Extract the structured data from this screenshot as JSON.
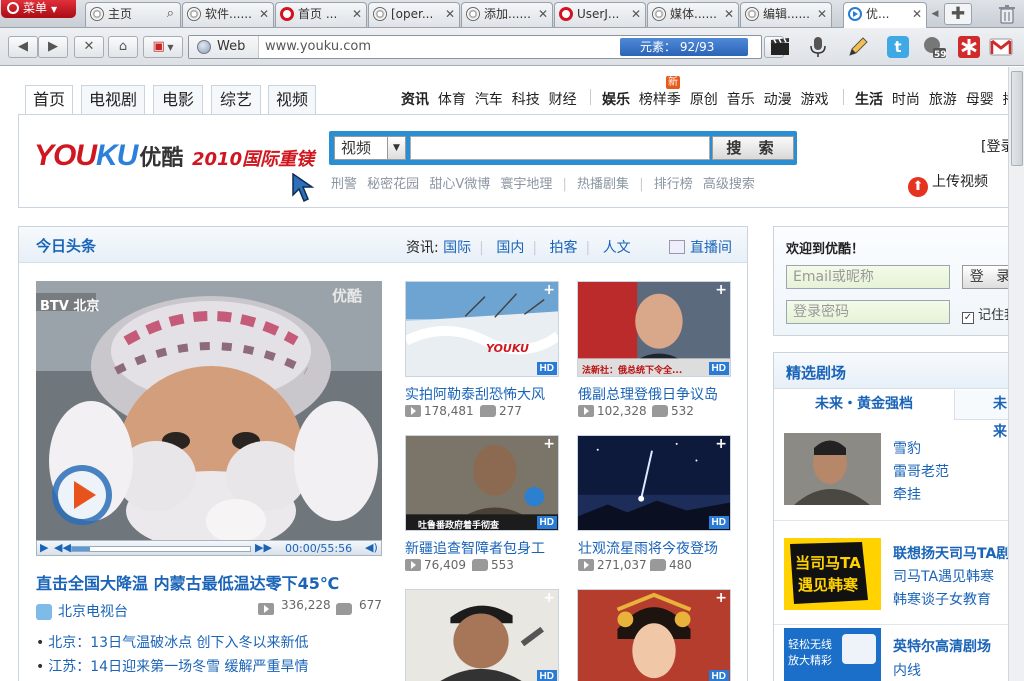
{
  "browser": {
    "menu_label": "菜单",
    "tabs": [
      {
        "label": "主页",
        "icon": "swirl-icon"
      },
      {
        "label": "软件......",
        "icon": "swirl-icon"
      },
      {
        "label": "首页 ...",
        "icon": "opera-icon"
      },
      {
        "label": "[oper...",
        "icon": "dog-icon"
      },
      {
        "label": "添加......",
        "icon": "dog-icon"
      },
      {
        "label": "UserJ...",
        "icon": "opera-icon"
      },
      {
        "label": "媒体......",
        "icon": "dog-icon"
      },
      {
        "label": "编辑......",
        "icon": "dog-icon"
      },
      {
        "label": "优...",
        "icon": "youku-icon"
      }
    ],
    "address": {
      "web_label": "Web",
      "url": "www.youku.com",
      "element_badge": "元素：    92/93"
    },
    "badge_count": "59"
  },
  "site": {
    "channel_tabs": [
      "首页",
      "电视剧",
      "电影",
      "综艺",
      "视频"
    ],
    "subnav_groups": [
      {
        "lead": "资讯",
        "items": [
          "体育",
          "汽车",
          "科技",
          "财经"
        ]
      },
      {
        "lead": "娱乐",
        "items": [
          "榜样季",
          "原创",
          "音乐",
          "动漫",
          "游戏"
        ]
      },
      {
        "lead": "生活",
        "items": [
          "时尚",
          "旅游",
          "母婴",
          "播"
        ]
      }
    ],
    "new_badge": "新",
    "logo": {
      "you": "YOU",
      "ku": "KU",
      "cn": "优酷",
      "slogan": "2010国际重镁"
    },
    "search": {
      "category": "视频",
      "button": "搜 索",
      "hotwords": [
        "刑警",
        "秘密花园",
        "甜心V微博",
        "寰宇地理"
      ],
      "hotlinks": [
        "热播剧集",
        "排行榜",
        "高级搜索"
      ]
    },
    "login_link": "[登录",
    "upload_label": "上传视频"
  },
  "news": {
    "title": "今日头条",
    "links_lead": "资讯:",
    "links": [
      "国际",
      "国内",
      "拍客",
      "人文"
    ],
    "live": "直播间",
    "main_video": {
      "watermark_left": "BTV 北京",
      "watermark_right": "优酷",
      "time": "00:00/55:56",
      "headline": "直击全国大降温 内蒙古最低温达零下45℃",
      "source": "北京电视台",
      "plays": "336,228",
      "comments": "677"
    },
    "bullets": [
      "北京：13日气温破冰点 创下入冬以来新低",
      "江苏：14日迎来第一场冬雪 缓解严重旱情"
    ],
    "thumbs": [
      {
        "title": "实拍阿勒泰刮恐怖大风",
        "plays": "178,481",
        "comments": "277",
        "hd": "HD",
        "logo": "YOUKU"
      },
      {
        "title": "俄副总理登俄日争议岛",
        "plays": "102,328",
        "comments": "532",
        "hd": "HD",
        "caption": "法新社：俄总统下令全..."
      },
      {
        "title": "新疆追查智障者包身工",
        "plays": "76,409",
        "comments": "553",
        "hd": "HD",
        "caption": "吐鲁番政府着手彻查"
      },
      {
        "title": "壮观流星雨将今夜登场",
        "plays": "271,037",
        "comments": "480",
        "hd": "HD"
      },
      {
        "title": "",
        "hd": "HD"
      },
      {
        "title": "",
        "hd": "HD"
      }
    ]
  },
  "login": {
    "welcome": "欢迎到优酷！",
    "user_placeholder": "Email或昵称",
    "pass_placeholder": "登录密码",
    "button": "登 录",
    "remember": "记住我"
  },
  "theater": {
    "title": "精选剧场",
    "tabs": [
      "未来・黄金强档",
      "未来"
    ],
    "rows": [
      {
        "links": [
          "雪豹",
          "雷哥老范",
          "牵挂"
        ],
        "bold_first": false
      },
      {
        "links": [
          "联想扬天司马TA剧",
          "司马TA遇见韩寒",
          "韩寒谈子女教育"
        ],
        "bold_first": true,
        "poster": "当司马TA遇见韩寒"
      },
      {
        "links": [
          "英特尔高清剧场",
          "内线"
        ],
        "bold_first": true,
        "poster": "轻松无线 放大精彩"
      }
    ]
  },
  "colors": {
    "link": "#1a64b8",
    "brand_red": "#d0161f",
    "brand_blue": "#2b80d9",
    "search_border": "#2a8ed0"
  }
}
